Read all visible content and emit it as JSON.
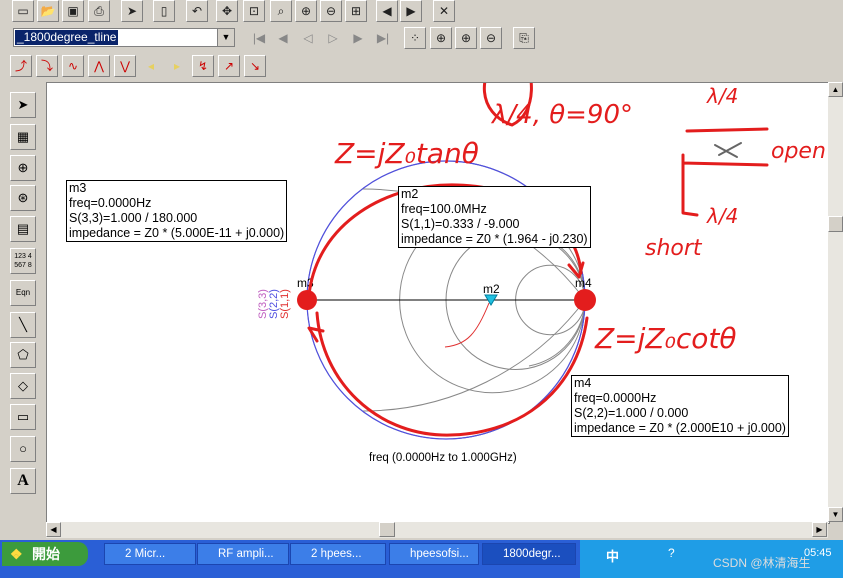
{
  "toolbar": {
    "design_select": "_1800degree_tline"
  },
  "markers": {
    "m3": {
      "name": "m3",
      "freq": "freq=0.0000Hz",
      "s": "S(3,3)=1.000 / 180.000",
      "imp": "impedance = Z0 * (5.000E-11 + j0.000)"
    },
    "m2": {
      "name": "m2",
      "freq": "freq=100.0MHz",
      "s": "S(1,1)=0.333 / -9.000",
      "imp": "impedance = Z0 * (1.964 - j0.230)"
    },
    "m4": {
      "name": "m4",
      "freq": "freq=0.0000Hz",
      "s": "S(2,2)=1.000 / 0.000",
      "imp": "impedance = Z0 * (2.000E10 + j0.000)"
    }
  },
  "smith": {
    "freq_label": "freq (0.0000Hz to 1.000GHz)",
    "legend": [
      "S(3,3)",
      "S(2,2)",
      "S(1,1)"
    ],
    "legend_colors": [
      "#c060c0",
      "#5050e0",
      "#e03030"
    ],
    "marker_labels": [
      "m3",
      "m2",
      "m4"
    ]
  },
  "annotations": {
    "quarter_wave": "λ/4, θ=90°",
    "z_tan": "Z=jZ₀tanθ",
    "z_cot": "Z=jZ₀cotθ",
    "open": "open",
    "short": "short",
    "lambda4": "λ/4"
  },
  "palette_text": {
    "numbers": "123 4\n567 8",
    "eqn": "Eqn",
    "text": "A"
  },
  "taskbar": {
    "start": "開始",
    "tasks": [
      "2 Micr...",
      "RF ampli...",
      "2 hpees...",
      "hpeesofsi...",
      "1800degr..."
    ],
    "time": "05:45",
    "watermark": "CSDN @林清海生"
  },
  "colors": {
    "ink": "#e31d1d",
    "selection": "#0a246a",
    "taskbar": "#2a5fd6"
  }
}
